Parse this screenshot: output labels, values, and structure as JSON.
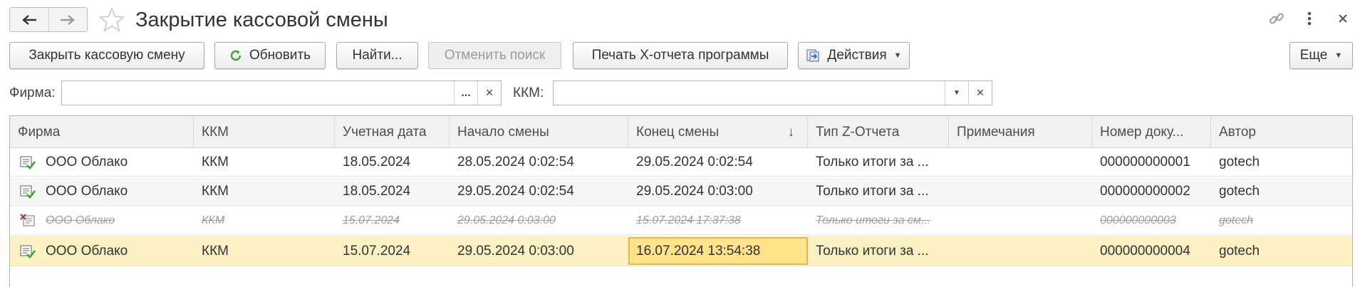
{
  "window": {
    "title": "Закрытие кассовой смены",
    "icons": [
      "arrow-left-icon",
      "arrow-right-icon",
      "star-icon",
      "link-icon",
      "more-icon",
      "close-icon"
    ]
  },
  "toolbar": {
    "close_shift": "Закрыть кассовую смену",
    "refresh": "Обновить",
    "find": "Найти...",
    "cancel_search": "Отменить поиск",
    "print_x": "Печать X-отчета программы",
    "actions": "Действия",
    "more": "Еще"
  },
  "filters": {
    "firm_label": "Фирма:",
    "firm_value": "",
    "firm_select": "...",
    "firm_clear": "×",
    "kkm_label": "ККМ:",
    "kkm_value": "",
    "kkm_clear": "×"
  },
  "table": {
    "columns": [
      "Фирма",
      "ККМ",
      "Учетная дата",
      "Начало смены",
      "Конец смены",
      "Тип Z-Отчета",
      "Примечания",
      "Номер доку...",
      "Автор"
    ],
    "sort_indicator": "↓",
    "rows": [
      {
        "firm": "ООО Облако",
        "kkm": "ККМ",
        "date": "18.05.2024",
        "start": "28.05.2024 0:02:54",
        "end": "29.05.2024 0:02:54",
        "type": "Только итоги за ...",
        "notes": "",
        "number": "000000000001",
        "author": "gotech",
        "status": "posted"
      },
      {
        "firm": "ООО Облако",
        "kkm": "ККМ",
        "date": "18.05.2024",
        "start": "29.05.2024 0:02:54",
        "end": "29.05.2024 0:03:00",
        "type": "Только итоги за ...",
        "notes": "",
        "number": "000000000002",
        "author": "gotech",
        "status": "posted"
      },
      {
        "firm": "ООО Облако",
        "kkm": "ККМ",
        "date": "15.07.2024",
        "start": "29.05.2024 0:03:00",
        "end": "15.07.2024 17:37:38",
        "type": "Только итоги за см...",
        "notes": "",
        "number": "000000000003",
        "author": "gotech",
        "status": "deleted"
      },
      {
        "firm": "ООО Облако",
        "kkm": "ККМ",
        "date": "15.07.2024",
        "start": "29.05.2024 0:03:00",
        "end": "16.07.2024 13:54:38",
        "type": "Только итоги за ...",
        "notes": "",
        "number": "000000000004",
        "author": "gotech",
        "status": "posted"
      }
    ]
  },
  "colors": {
    "selected_row": "#fbf1c4",
    "focused_cell": "#ffe289",
    "posted_icon": "#3aa335",
    "deleted_icon": "#d9262c"
  }
}
